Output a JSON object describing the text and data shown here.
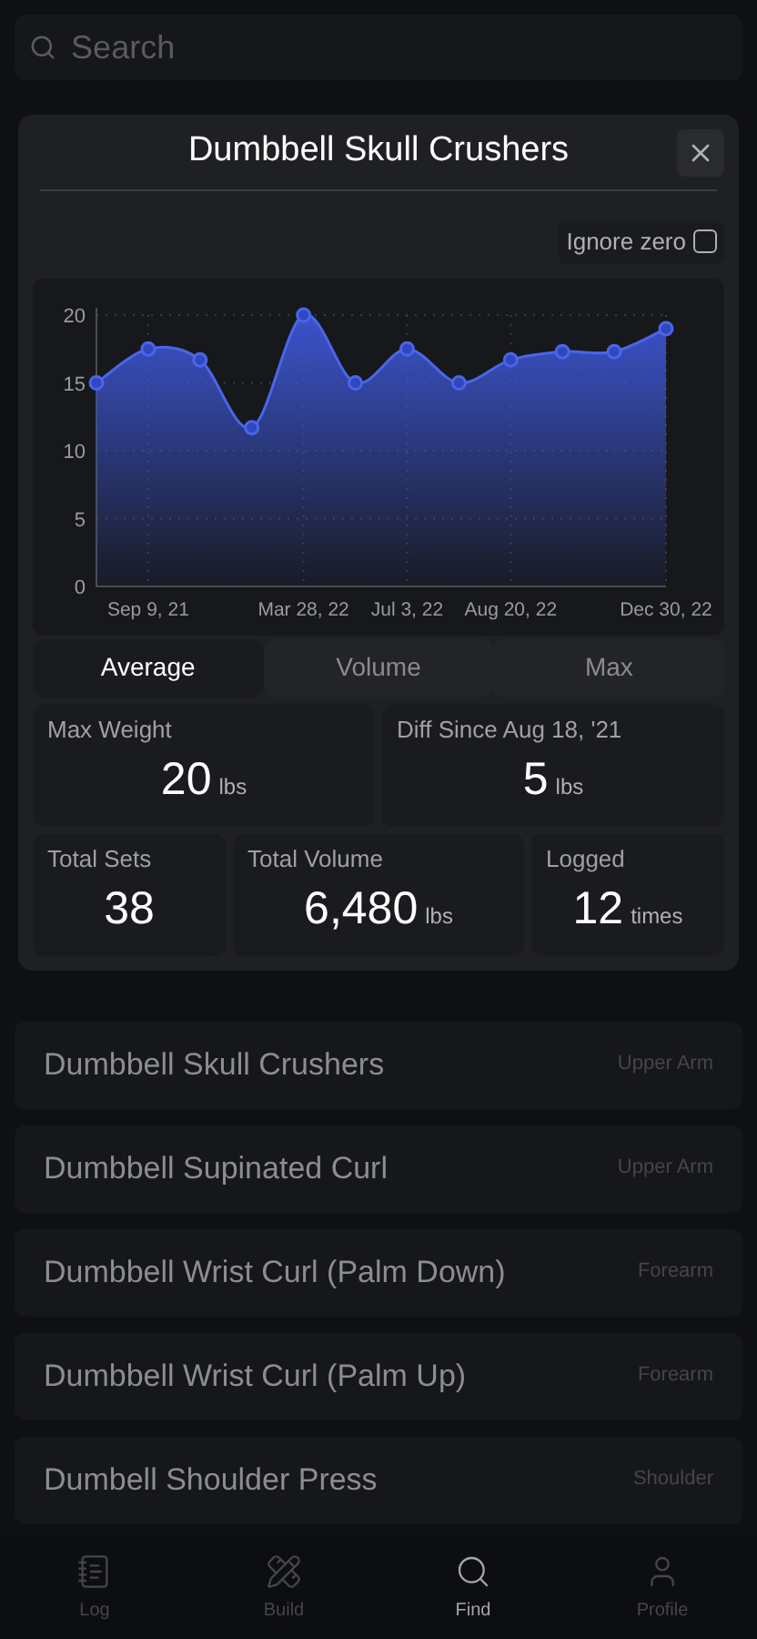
{
  "search": {
    "placeholder": "Search"
  },
  "modal": {
    "title": "Dumbbell Skull Crushers",
    "ignore_zero": {
      "label": "Ignore zero",
      "checked": false
    },
    "chart_data": {
      "type": "area",
      "categories": [
        null,
        "Sep 9, 21",
        null,
        null,
        "Mar 28, 22",
        null,
        "Jul 3, 22",
        null,
        "Aug 20, 22",
        null,
        null,
        "Dec 30, 22"
      ],
      "series": [
        {
          "color": "#4a66e8",
          "values": [
            15,
            17.5,
            16.7,
            11.7,
            20,
            15,
            17.5,
            15,
            16.7,
            17.3,
            17.3,
            19
          ]
        }
      ],
      "ylim": [
        0,
        20
      ],
      "yticks": [
        0,
        5,
        10,
        15,
        20
      ],
      "grid": true
    },
    "tabs": [
      {
        "label": "Average",
        "selected": true
      },
      {
        "label": "Volume",
        "selected": false
      },
      {
        "label": "Max",
        "selected": false
      }
    ],
    "stats_top": [
      {
        "label": "Max Weight",
        "value": "20",
        "unit": "lbs"
      },
      {
        "label": "Diff Since Aug 18, '21",
        "value": "5",
        "unit": "lbs"
      }
    ],
    "stats_bottom": [
      {
        "label": "Total Sets",
        "value": "38"
      },
      {
        "label": "Total Volume",
        "value": "6,480",
        "unit": "lbs"
      },
      {
        "label": "Logged",
        "value": "12",
        "unit": "times"
      }
    ]
  },
  "exercises": [
    {
      "name": "Dumbbell Skull Crushers",
      "category": "Upper Arm"
    },
    {
      "name": "Dumbbell Supinated Curl",
      "category": "Upper Arm"
    },
    {
      "name": "Dumbbell Wrist Curl (Palm Down)",
      "category": "Forearm"
    },
    {
      "name": "Dumbbell Wrist Curl (Palm Up)",
      "category": "Forearm"
    },
    {
      "name": "Dumbell Shoulder Press",
      "category": "Shoulder"
    }
  ],
  "nav": [
    {
      "label": "Log",
      "kind": "log",
      "selected": false
    },
    {
      "label": "Build",
      "kind": "build",
      "selected": false
    },
    {
      "label": "Find",
      "kind": "find",
      "selected": true
    },
    {
      "label": "Profile",
      "kind": "profile",
      "selected": false
    }
  ]
}
